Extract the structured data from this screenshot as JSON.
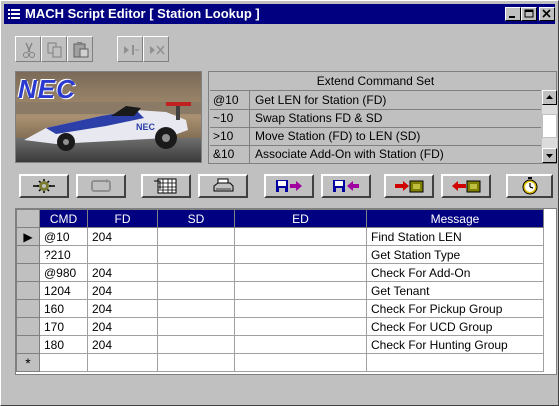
{
  "window": {
    "title": "MACH Script Editor [ Station Lookup ]"
  },
  "command_set": {
    "header": "Extend Command Set",
    "items": [
      {
        "code": "@10",
        "description": "Get LEN for Station (FD)"
      },
      {
        "code": "~10",
        "description": "Swap Stations FD & SD"
      },
      {
        "code": ">10",
        "description": "Move Station (FD) to LEN (SD)"
      },
      {
        "code": "&10",
        "description": "Associate Add-On with Station (FD)"
      }
    ]
  },
  "banner": {
    "logo_text": "NEC"
  },
  "grid": {
    "columns": [
      "CMD",
      "FD",
      "SD",
      "ED",
      "Message"
    ],
    "rows": [
      {
        "cmd": "@10",
        "fd": "204",
        "sd": "",
        "ed": "",
        "message": "Find Station LEN"
      },
      {
        "cmd": "?210",
        "fd": "",
        "sd": "",
        "ed": "",
        "message": "Get Station Type"
      },
      {
        "cmd": "@980",
        "fd": "204",
        "sd": "",
        "ed": "",
        "message": "Check For Add-On"
      },
      {
        "cmd": "1204",
        "fd": "204",
        "sd": "",
        "ed": "",
        "message": "Get Tenant"
      },
      {
        "cmd": "160",
        "fd": "204",
        "sd": "",
        "ed": "",
        "message": "Check For Pickup Group"
      },
      {
        "cmd": "170",
        "fd": "204",
        "sd": "",
        "ed": "",
        "message": "Check For UCD Group"
      },
      {
        "cmd": "180",
        "fd": "204",
        "sd": "",
        "ed": "",
        "message": "Check For Hunting Group"
      }
    ],
    "new_row_marker": "*",
    "current_row_marker": "▶"
  },
  "colors": {
    "titlebar": "#000080",
    "grid_header": "#000080",
    "face": "#c0c0c0"
  }
}
